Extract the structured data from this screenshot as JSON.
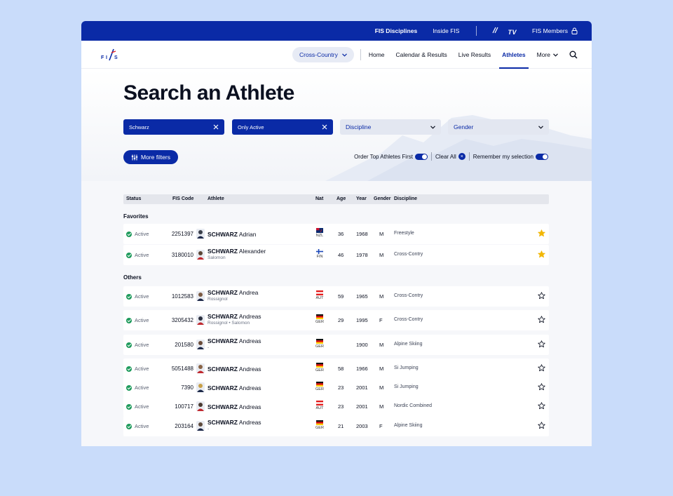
{
  "topbar": {
    "disciplines": "FIS Disciplines",
    "inside": "Inside FIS",
    "tv": "TV",
    "members": "FIS Members"
  },
  "nav": {
    "discipline": "Cross-Country",
    "links": [
      "Home",
      "Calendar & Results",
      "Live Results",
      "Athletes"
    ],
    "more": "More"
  },
  "page": {
    "title": "Search an Athlete"
  },
  "filters": {
    "search": "Schwarz",
    "status": "Only Active",
    "discipline": "Discipline",
    "gender": "Gender",
    "more": "More filters"
  },
  "options": {
    "order": "Order Top Athletes First",
    "clear": "Clear All",
    "remember": "Remember my selection"
  },
  "table": {
    "headers": {
      "status": "Status",
      "code": "FIS Code",
      "athlete": "Athlete",
      "nat": "Nat",
      "age": "Age",
      "year": "Year",
      "gender": "Gender",
      "discipline": "Discipline"
    },
    "favorites_label": "Favorites",
    "others_label": "Others",
    "favorites": [
      {
        "status": "Active",
        "code": "2251397",
        "last": "SCHWARZ",
        "first": "Adrian",
        "sub": "",
        "nat": "NZL",
        "age": "36",
        "year": "1968",
        "gender": "M",
        "discipline": "Freestyle",
        "favorite": true
      },
      {
        "status": "Active",
        "code": "3180010",
        "last": "SCHWARZ",
        "first": "Alexander",
        "sub": "Salomon",
        "nat": "FIN",
        "age": "46",
        "year": "1978",
        "gender": "M",
        "discipline": "Cross-Contry",
        "favorite": true
      }
    ],
    "others": [
      {
        "status": "Active",
        "code": "1012583",
        "last": "SCHWARZ",
        "first": "Andrea",
        "sub": "Rossignol",
        "nat": "AUT",
        "age": "59",
        "year": "1965",
        "gender": "M",
        "discipline": "Cross-Contry",
        "favorite": false
      },
      {
        "status": "Active",
        "code": "3205432",
        "last": "SCHWARZ",
        "first": "Andreas",
        "sub": "Rossignol • Salomon",
        "nat": "GER",
        "age": "29",
        "year": "1995",
        "gender": "F",
        "discipline": "Cross-Contry",
        "favorite": false
      },
      {
        "status": "Active",
        "code": "201580",
        "last": "SCHWARZ",
        "first": "Andreas",
        "sub": "-",
        "nat": "GER",
        "age": "",
        "year": "1900",
        "gender": "M",
        "discipline": "Alpine Skiing",
        "favorite": false
      },
      {
        "status": "Active",
        "code": "5051488",
        "last": "SCHWARZ",
        "first": "Andreas",
        "sub": "",
        "nat": "GER",
        "age": "58",
        "year": "1966",
        "gender": "M",
        "discipline": "Si Jumping",
        "favorite": false
      },
      {
        "status": "Active",
        "code": "7390",
        "last": "SCHWARZ",
        "first": "Andreas",
        "sub": "",
        "nat": "GER",
        "age": "23",
        "year": "2001",
        "gender": "M",
        "discipline": "Si Jumping",
        "favorite": false
      },
      {
        "status": "Active",
        "code": "100717",
        "last": "SCHWARZ",
        "first": "Andreas",
        "sub": "",
        "nat": "AUT",
        "age": "23",
        "year": "2001",
        "gender": "M",
        "discipline": "Nordic Combined",
        "favorite": false
      },
      {
        "status": "Active",
        "code": "203164",
        "last": "SCHWARZ",
        "first": "Andreas",
        "sub": "-",
        "nat": "GER",
        "age": "21",
        "year": "2003",
        "gender": "F",
        "discipline": "Alpine Skiing",
        "favorite": false
      }
    ]
  },
  "colors": {
    "brand": "#0a2aa6",
    "active": "#1d9a5b",
    "star": "#f2b705"
  }
}
